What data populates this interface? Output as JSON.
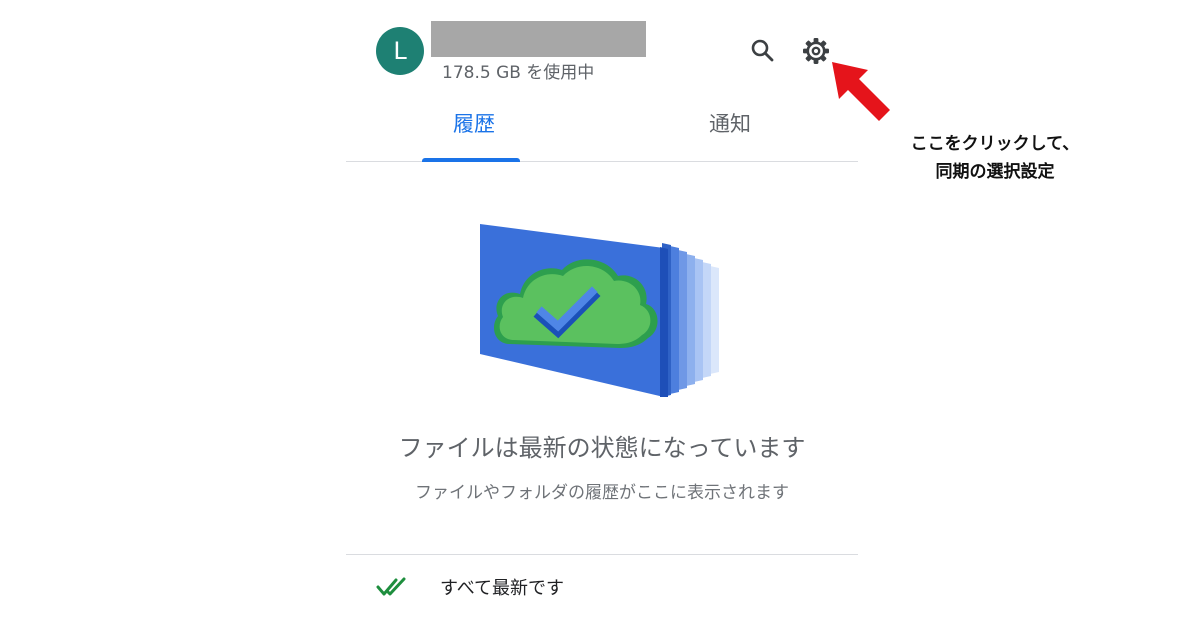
{
  "header": {
    "avatar_letter": "L",
    "storage_usage": "178.5 GB を使用中",
    "search_icon": "search-icon",
    "settings_icon": "gear-icon"
  },
  "tabs": [
    {
      "label": "履歴",
      "active": true
    },
    {
      "label": "通知",
      "active": false
    }
  ],
  "empty_state": {
    "title": "ファイルは最新の状態になっています",
    "description": "ファイルやフォルダの履歴がここに表示されます"
  },
  "status": {
    "icon": "double-check-icon",
    "text": "すべて最新です"
  },
  "annotation": {
    "line1": "ここをクリックして、",
    "line2": "同期の選択設定",
    "arrow_color": "#e5141b"
  },
  "colors": {
    "accent": "#1a73e8",
    "avatar": "#1e8073",
    "status_green": "#1e8e3e"
  }
}
